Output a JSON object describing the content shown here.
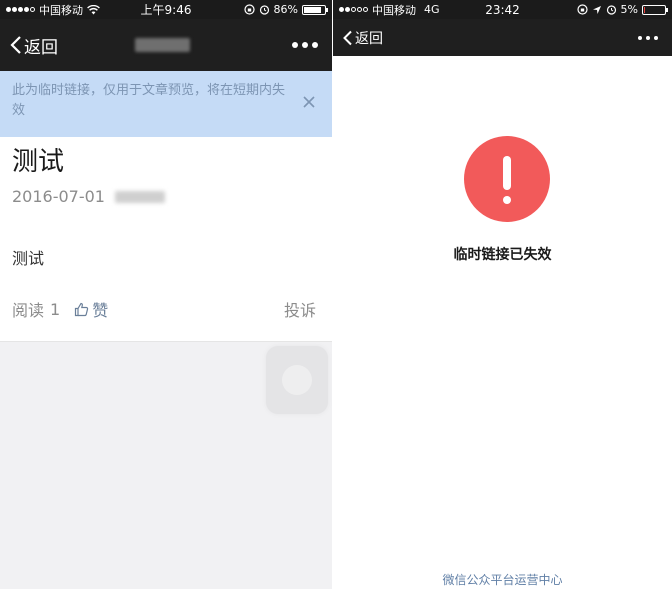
{
  "left": {
    "status": {
      "carrier": "中国移动",
      "time": "上午9:46",
      "battery": "86%",
      "battery_level": 0.86
    },
    "nav": {
      "back_label": "返回"
    },
    "banner": {
      "text": "此为临时链接，仅用于文章预览，将在短期内失效"
    },
    "article": {
      "title": "测试",
      "date": "2016-07-01",
      "body": "测试",
      "read_label": "阅读",
      "read_count": "1",
      "like_label": "赞",
      "report_label": "投诉"
    }
  },
  "right": {
    "status": {
      "carrier": "中国移动",
      "network": "4G",
      "time": "23:42",
      "battery": "5%",
      "battery_level": 0.05
    },
    "nav": {
      "back_label": "返回"
    },
    "error": {
      "message": "临时链接已失效"
    },
    "footer": {
      "link": "微信公众平台运营中心"
    }
  },
  "colors": {
    "banner_bg": "#c5dbf6",
    "error_red": "#f25a5a",
    "link_blue": "#607fa6"
  }
}
